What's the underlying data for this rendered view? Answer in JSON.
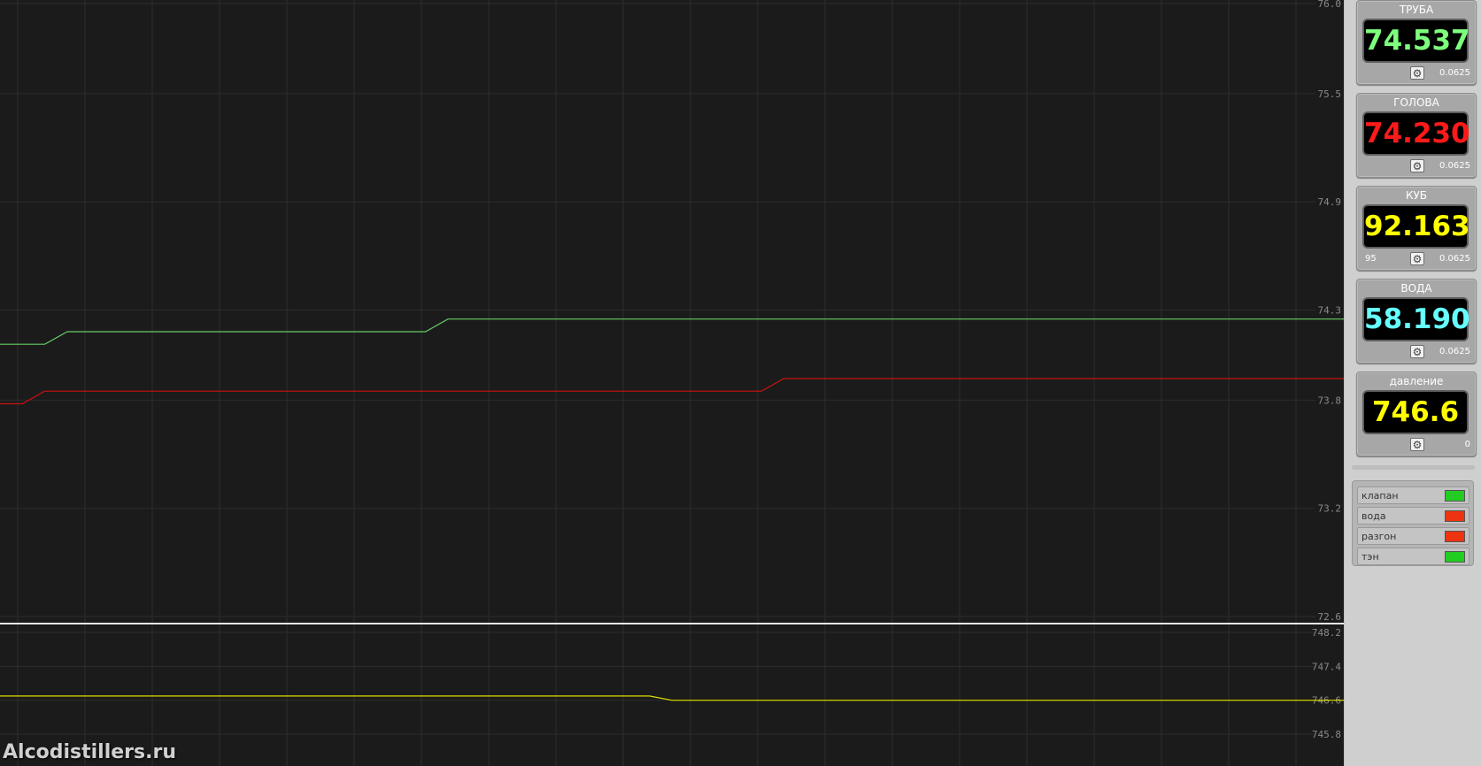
{
  "chart_data": [
    {
      "type": "line",
      "title": "",
      "xlabel": "",
      "ylabel": "",
      "y_ticks": [
        "76.0",
        "75.5",
        "74.9",
        "74.3",
        "73.8",
        "73.2",
        "72.6"
      ],
      "ylim": [
        72.6,
        76.0
      ],
      "grid": true,
      "series": [
        {
          "color": "#66cc66",
          "values": [
            74.11,
            74.11,
            74.11,
            74.18,
            74.18,
            74.18,
            74.18,
            74.18,
            74.18,
            74.18,
            74.18,
            74.18,
            74.18,
            74.18,
            74.18,
            74.18,
            74.18,
            74.18,
            74.18,
            74.18,
            74.25,
            74.25,
            74.25,
            74.25,
            74.25,
            74.25,
            74.25,
            74.25,
            74.25,
            74.25,
            74.25,
            74.25,
            74.25,
            74.25,
            74.25,
            74.25,
            74.25,
            74.25,
            74.25,
            74.25,
            74.25,
            74.25,
            74.25,
            74.25,
            74.25,
            74.25,
            74.25,
            74.25,
            74.25,
            74.25,
            74.25,
            74.25,
            74.25,
            74.25,
            74.25,
            74.25,
            74.25,
            74.25,
            74.25,
            74.25,
            74.25
          ]
        },
        {
          "color": "#cc1111",
          "values": [
            73.78,
            73.78,
            73.85,
            73.85,
            73.85,
            73.85,
            73.85,
            73.85,
            73.85,
            73.85,
            73.85,
            73.85,
            73.85,
            73.85,
            73.85,
            73.85,
            73.85,
            73.85,
            73.85,
            73.85,
            73.85,
            73.85,
            73.85,
            73.85,
            73.85,
            73.85,
            73.85,
            73.85,
            73.85,
            73.85,
            73.85,
            73.85,
            73.85,
            73.85,
            73.85,
            73.92,
            73.92,
            73.92,
            73.92,
            73.92,
            73.92,
            73.92,
            73.92,
            73.92,
            73.92,
            73.92,
            73.92,
            73.92,
            73.92,
            73.92,
            73.92,
            73.92,
            73.92,
            73.92,
            73.92,
            73.92,
            73.92,
            73.92,
            73.92,
            73.92,
            73.92
          ]
        }
      ]
    },
    {
      "type": "line",
      "title": "",
      "xlabel": "",
      "ylabel": "",
      "y_ticks": [
        "748.2",
        "747.4",
        "746.6",
        "745.8"
      ],
      "ylim": [
        745.4,
        748.2
      ],
      "grid": true,
      "series": [
        {
          "color": "#e0e000",
          "values": [
            746.7,
            746.7,
            746.7,
            746.7,
            746.7,
            746.7,
            746.7,
            746.7,
            746.7,
            746.7,
            746.7,
            746.7,
            746.7,
            746.7,
            746.7,
            746.7,
            746.7,
            746.7,
            746.7,
            746.7,
            746.7,
            746.7,
            746.7,
            746.7,
            746.7,
            746.7,
            746.7,
            746.7,
            746.7,
            746.7,
            746.6,
            746.6,
            746.6,
            746.6,
            746.6,
            746.6,
            746.6,
            746.6,
            746.6,
            746.6,
            746.6,
            746.6,
            746.6,
            746.6,
            746.6,
            746.6,
            746.6,
            746.6,
            746.6,
            746.6,
            746.6,
            746.6,
            746.6,
            746.6,
            746.6,
            746.6,
            746.6,
            746.6,
            746.6,
            746.6,
            746.6
          ]
        }
      ]
    }
  ],
  "watermark": "Alcodistillers.ru",
  "sensors": [
    {
      "title": "ТРУБА",
      "value": "74.537",
      "color": "#7dff7d",
      "step": "0.0625",
      "left": ""
    },
    {
      "title": "ГОЛОВА",
      "value": "74.230",
      "color": "#ff1a1a",
      "step": "0.0625",
      "left": ""
    },
    {
      "title": "КУБ",
      "value": "92.163",
      "color": "#ffff00",
      "step": "0.0625",
      "left": "95"
    },
    {
      "title": "ВОДА",
      "value": "58.190",
      "color": "#66ffff",
      "step": "0.0625",
      "left": ""
    },
    {
      "title": "давление",
      "value": "746.6",
      "color": "#ffff00",
      "step": "0",
      "left": ""
    }
  ],
  "gear_icon": "gear-icon",
  "statuses": [
    {
      "label": "клапан",
      "color": "#22cc22"
    },
    {
      "label": "вода",
      "color": "#ee3311"
    },
    {
      "label": "разгон",
      "color": "#ee3311"
    },
    {
      "label": "тэн",
      "color": "#22cc22"
    }
  ]
}
